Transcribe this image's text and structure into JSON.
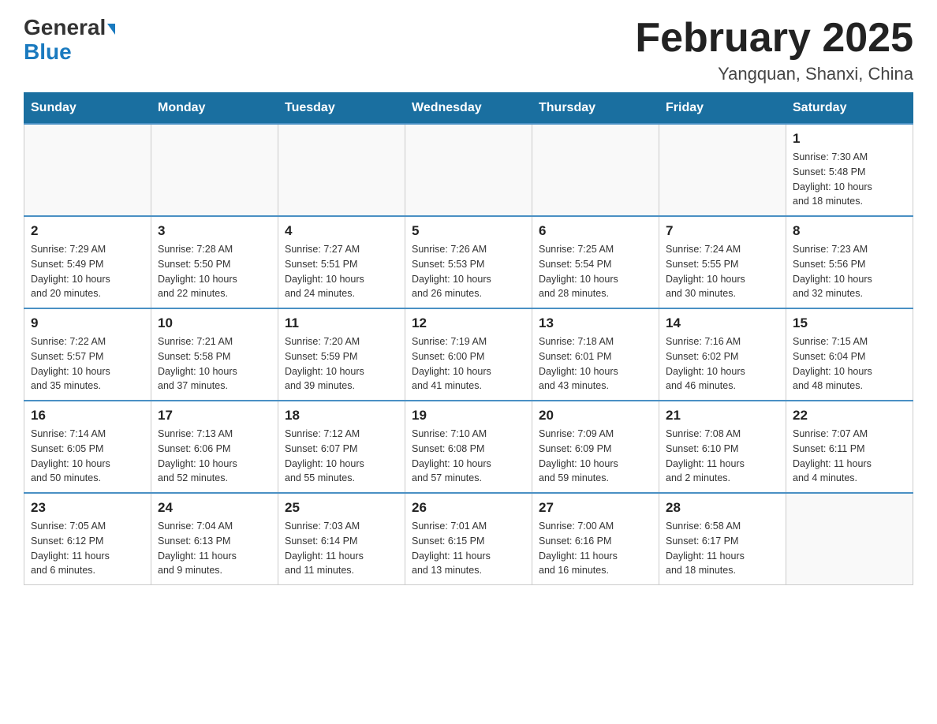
{
  "header": {
    "logo_general": "General",
    "logo_blue": "Blue",
    "month_title": "February 2025",
    "location": "Yangquan, Shanxi, China"
  },
  "weekdays": [
    "Sunday",
    "Monday",
    "Tuesday",
    "Wednesday",
    "Thursday",
    "Friday",
    "Saturday"
  ],
  "weeks": [
    [
      {
        "day": "",
        "info": ""
      },
      {
        "day": "",
        "info": ""
      },
      {
        "day": "",
        "info": ""
      },
      {
        "day": "",
        "info": ""
      },
      {
        "day": "",
        "info": ""
      },
      {
        "day": "",
        "info": ""
      },
      {
        "day": "1",
        "info": "Sunrise: 7:30 AM\nSunset: 5:48 PM\nDaylight: 10 hours\nand 18 minutes."
      }
    ],
    [
      {
        "day": "2",
        "info": "Sunrise: 7:29 AM\nSunset: 5:49 PM\nDaylight: 10 hours\nand 20 minutes."
      },
      {
        "day": "3",
        "info": "Sunrise: 7:28 AM\nSunset: 5:50 PM\nDaylight: 10 hours\nand 22 minutes."
      },
      {
        "day": "4",
        "info": "Sunrise: 7:27 AM\nSunset: 5:51 PM\nDaylight: 10 hours\nand 24 minutes."
      },
      {
        "day": "5",
        "info": "Sunrise: 7:26 AM\nSunset: 5:53 PM\nDaylight: 10 hours\nand 26 minutes."
      },
      {
        "day": "6",
        "info": "Sunrise: 7:25 AM\nSunset: 5:54 PM\nDaylight: 10 hours\nand 28 minutes."
      },
      {
        "day": "7",
        "info": "Sunrise: 7:24 AM\nSunset: 5:55 PM\nDaylight: 10 hours\nand 30 minutes."
      },
      {
        "day": "8",
        "info": "Sunrise: 7:23 AM\nSunset: 5:56 PM\nDaylight: 10 hours\nand 32 minutes."
      }
    ],
    [
      {
        "day": "9",
        "info": "Sunrise: 7:22 AM\nSunset: 5:57 PM\nDaylight: 10 hours\nand 35 minutes."
      },
      {
        "day": "10",
        "info": "Sunrise: 7:21 AM\nSunset: 5:58 PM\nDaylight: 10 hours\nand 37 minutes."
      },
      {
        "day": "11",
        "info": "Sunrise: 7:20 AM\nSunset: 5:59 PM\nDaylight: 10 hours\nand 39 minutes."
      },
      {
        "day": "12",
        "info": "Sunrise: 7:19 AM\nSunset: 6:00 PM\nDaylight: 10 hours\nand 41 minutes."
      },
      {
        "day": "13",
        "info": "Sunrise: 7:18 AM\nSunset: 6:01 PM\nDaylight: 10 hours\nand 43 minutes."
      },
      {
        "day": "14",
        "info": "Sunrise: 7:16 AM\nSunset: 6:02 PM\nDaylight: 10 hours\nand 46 minutes."
      },
      {
        "day": "15",
        "info": "Sunrise: 7:15 AM\nSunset: 6:04 PM\nDaylight: 10 hours\nand 48 minutes."
      }
    ],
    [
      {
        "day": "16",
        "info": "Sunrise: 7:14 AM\nSunset: 6:05 PM\nDaylight: 10 hours\nand 50 minutes."
      },
      {
        "day": "17",
        "info": "Sunrise: 7:13 AM\nSunset: 6:06 PM\nDaylight: 10 hours\nand 52 minutes."
      },
      {
        "day": "18",
        "info": "Sunrise: 7:12 AM\nSunset: 6:07 PM\nDaylight: 10 hours\nand 55 minutes."
      },
      {
        "day": "19",
        "info": "Sunrise: 7:10 AM\nSunset: 6:08 PM\nDaylight: 10 hours\nand 57 minutes."
      },
      {
        "day": "20",
        "info": "Sunrise: 7:09 AM\nSunset: 6:09 PM\nDaylight: 10 hours\nand 59 minutes."
      },
      {
        "day": "21",
        "info": "Sunrise: 7:08 AM\nSunset: 6:10 PM\nDaylight: 11 hours\nand 2 minutes."
      },
      {
        "day": "22",
        "info": "Sunrise: 7:07 AM\nSunset: 6:11 PM\nDaylight: 11 hours\nand 4 minutes."
      }
    ],
    [
      {
        "day": "23",
        "info": "Sunrise: 7:05 AM\nSunset: 6:12 PM\nDaylight: 11 hours\nand 6 minutes."
      },
      {
        "day": "24",
        "info": "Sunrise: 7:04 AM\nSunset: 6:13 PM\nDaylight: 11 hours\nand 9 minutes."
      },
      {
        "day": "25",
        "info": "Sunrise: 7:03 AM\nSunset: 6:14 PM\nDaylight: 11 hours\nand 11 minutes."
      },
      {
        "day": "26",
        "info": "Sunrise: 7:01 AM\nSunset: 6:15 PM\nDaylight: 11 hours\nand 13 minutes."
      },
      {
        "day": "27",
        "info": "Sunrise: 7:00 AM\nSunset: 6:16 PM\nDaylight: 11 hours\nand 16 minutes."
      },
      {
        "day": "28",
        "info": "Sunrise: 6:58 AM\nSunset: 6:17 PM\nDaylight: 11 hours\nand 18 minutes."
      },
      {
        "day": "",
        "info": ""
      }
    ]
  ]
}
